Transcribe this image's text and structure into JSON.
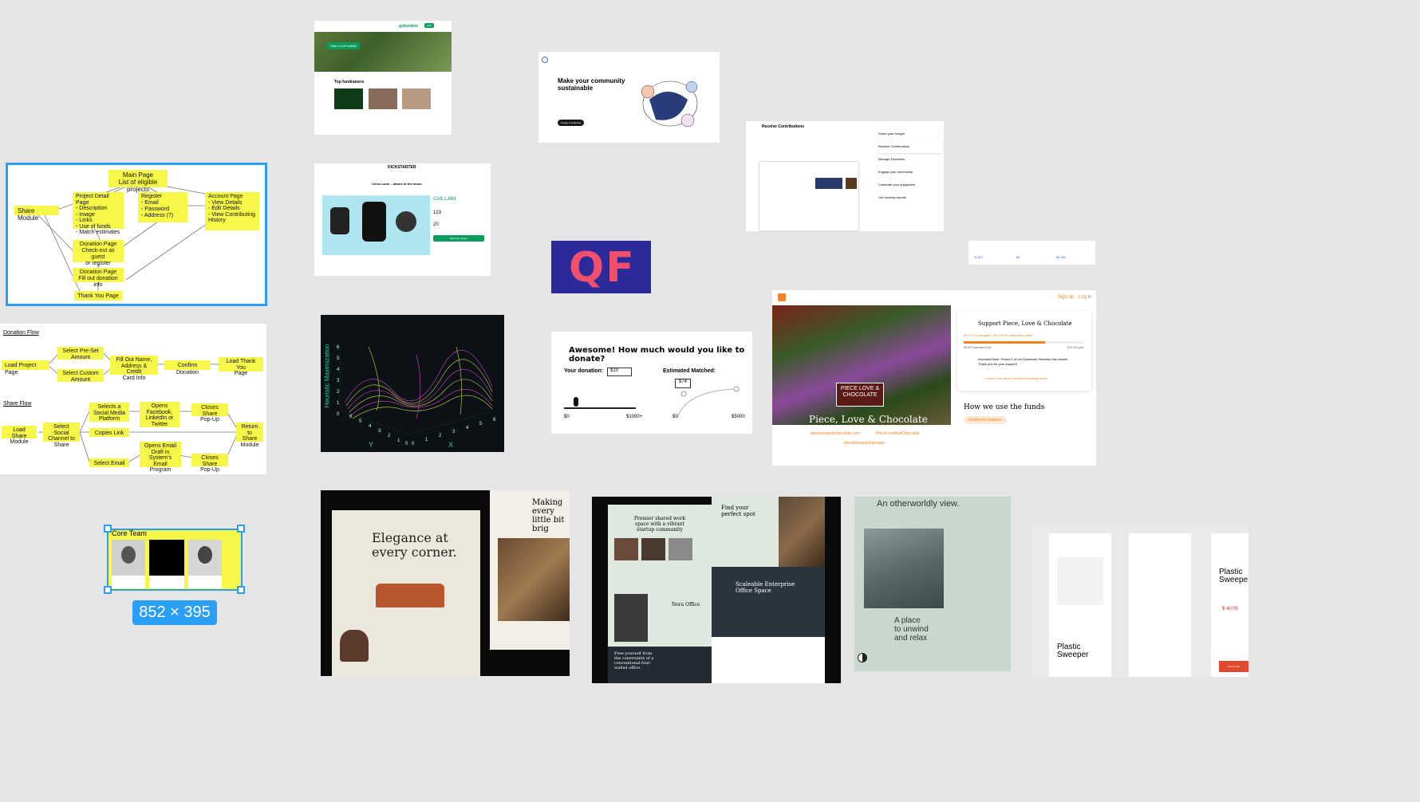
{
  "flowchart": {
    "main_page": "Main Page\nList of eligible projects",
    "share_module": "Share Module",
    "project_detail": "Project Detail Page\n-  Description\n-  Image\n-  Links\n-  Use of funds\n-  Match estimates",
    "register": "Register\n-  Email\n-  Password\n-  Address (?)",
    "account": "Account Page\n-  View Details\n-  Edit Details\n-  View Contributing\n   History",
    "donation_1": "Donation Page\nCheck-out as guest\nor register",
    "donation_2": "Donation Page\nFill out donation info",
    "thank_you": "Thank You Page"
  },
  "donation_flow": {
    "title": "Donation Flow",
    "load_project": "Load Project Page",
    "select_preset": "Select Pre-Set\nAmount",
    "select_custom": "Select Custom\nAmount",
    "fill_out": "Fill Out Name,\nAddress & Credit\nCard Info",
    "confirm": "Confirm Donation",
    "load_thank_you": "Load Thank You\nPage"
  },
  "share_flow": {
    "title": "Share Flow",
    "load_share": "Load Share\nModule",
    "select_social": "Select Social\nChannel to\nShare",
    "selects_social": "Selects a\nSocial Media\nPlatform",
    "opens_facebook": "Opens\nFacebook,\nLinkedIn or\nTwitter",
    "closes_1": "Closes Share\nPop-Up",
    "copies": "Copies Link",
    "return": "Return to\nShare\nModule",
    "select_email": "Select Email",
    "opens_email": "Opens Email\nDraft in\nSystem's Email\nProgram",
    "closes_2": "Closes Share\nPop-Up"
  },
  "core_team": {
    "title": "Core Team",
    "size_label": "852 × 395"
  },
  "gofundme": {
    "brand": "gofundme",
    "cta": "Start a GoFundMe",
    "heading": "Top fundraisers"
  },
  "opencollective": {
    "heading": "Make your community\nsustainable",
    "cta": "Create a Collective"
  },
  "receive": {
    "heading": "Receive Contributions",
    "items": [
      "Share your budget",
      "Receive Contributions",
      "Manage Expenses",
      "Engage your community",
      "Celebrate your supporters",
      "Get monthly reports"
    ]
  },
  "kickstarter": {
    "brand": "KICKSTARTER",
    "title": "Circa Lunar – attune to the moon",
    "pledged": "CA$ 1,884",
    "backers": "123",
    "days": "20",
    "cta": "Back this project"
  },
  "qf": {
    "logo": "QF"
  },
  "chart3d": {
    "zlabel": "Heuristic Maximization",
    "xlabel": "X",
    "ylabel": "Y",
    "zticks": [
      "6",
      "5",
      "4",
      "3",
      "2",
      "1",
      "0"
    ],
    "xticks": [
      "0",
      "1",
      "2",
      "3",
      "4",
      "5",
      "6"
    ],
    "yticks": [
      "6",
      "5",
      "4",
      "3",
      "2",
      "1",
      "0"
    ]
  },
  "donate_widget": {
    "question": "Awesome! How much would you like to donate?",
    "your_donation_label": "Your donation:",
    "your_donation_value": "$10",
    "matched_label": "Estimated Matched:",
    "matched_value": "$74",
    "min1": "$0",
    "max1": "$1000+",
    "min2": "$0",
    "max2": "$5000"
  },
  "stats_strip": {
    "v1": "71,817",
    "v2": "$0",
    "v3": "$4,981"
  },
  "piece_love": {
    "signup": "Sign up",
    "login": "Log in",
    "name": "Piece, Love & Chocolate",
    "sign_text": "PIECE LOVE & CHOCOLATE",
    "support_title": "Support Piece, Love & Chocolate",
    "donated": "$2,077.10 donated + $4,949.90 estimated match",
    "estimated_total": "$6,823 estimated total",
    "goal": "$10,000 goal",
    "note": "Important Note: Round 1 of the Downtown Stimulus has closed! Thank you for your support!",
    "learn_more": "Learn more about donation matching works",
    "funds_title": "How we use the funds",
    "funds_tag": "Employee Salaries",
    "link1": "pieceloveandchocolate.com",
    "link2": "PieceLoveAndChocolate",
    "link3": "pieceloveandchocolate"
  },
  "elegance": {
    "heading": "Elegance at\nevery corner.",
    "side_heading": "Making every\nlittle bit brig"
  },
  "cowork": {
    "hero": "Premier shared work\nspace with a vibrant\nstartup community",
    "find": "Find your\nperfect spot",
    "nera": "Nera Office",
    "enterprise": "Scaleable Enterprise\nOffice Space",
    "free": "Free yourself from\nthe constraints of a\nconventional four-\nwalled office."
  },
  "otherworldly": {
    "heading": "An otherworldly view.",
    "place": "A place\nto unwind\nand relax"
  },
  "sweeper": {
    "title": "Plastic\nSweeper",
    "title2": "Plastic\nSweepe",
    "price": "$ 40.00",
    "cta": "Add to Cart"
  },
  "colors": {
    "canvas": "#e5e5e5",
    "sticky": "#f7f74a",
    "selection": "#2b9ef5",
    "kickstarter_green": "#0b9b5a",
    "orange": "#f58220"
  }
}
